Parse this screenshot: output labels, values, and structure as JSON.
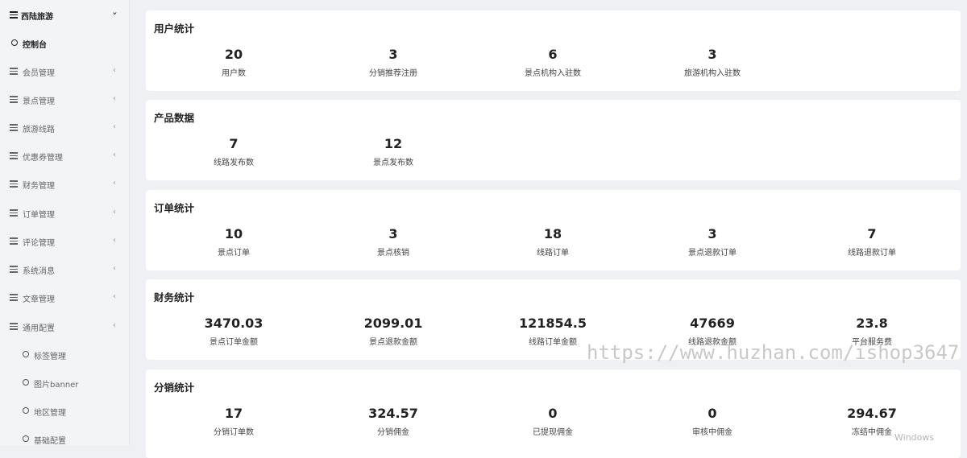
{
  "sidebar": {
    "header": "西陆旅游",
    "dashboard": "控制台",
    "menus": [
      "会员管理",
      "景点管理",
      "旅游线路",
      "优惠券管理",
      "财务管理",
      "订单管理",
      "评论管理",
      "系统消息",
      "文章管理",
      "通用配置"
    ],
    "submenus": [
      "标签管理",
      "图片banner",
      "地区管理",
      "基础配置"
    ]
  },
  "sections": [
    {
      "title": "用户统计",
      "stats": [
        {
          "value": "20",
          "label": "用户数"
        },
        {
          "value": "3",
          "label": "分销推荐注册"
        },
        {
          "value": "6",
          "label": "景点机构入驻数"
        },
        {
          "value": "3",
          "label": "旅游机构入驻数"
        }
      ]
    },
    {
      "title": "产品数据",
      "stats": [
        {
          "value": "7",
          "label": "线路发布数"
        },
        {
          "value": "12",
          "label": "景点发布数"
        }
      ]
    },
    {
      "title": "订单统计",
      "stats": [
        {
          "value": "10",
          "label": "景点订单"
        },
        {
          "value": "3",
          "label": "景点核销"
        },
        {
          "value": "18",
          "label": "线路订单"
        },
        {
          "value": "3",
          "label": "景点退款订单"
        },
        {
          "value": "7",
          "label": "线路退款订单"
        }
      ]
    },
    {
      "title": "财务统计",
      "stats": [
        {
          "value": "3470.03",
          "label": "景点订单金额"
        },
        {
          "value": "2099.01",
          "label": "景点退款金额"
        },
        {
          "value": "121854.5",
          "label": "线路订单金额"
        },
        {
          "value": "47669",
          "label": "线路退款金额"
        },
        {
          "value": "23.8",
          "label": "平台服务费"
        }
      ]
    },
    {
      "title": "分销统计",
      "stats": [
        {
          "value": "17",
          "label": "分销订单数"
        },
        {
          "value": "324.57",
          "label": "分销佣金"
        },
        {
          "value": "0",
          "label": "已提现佣金"
        },
        {
          "value": "0",
          "label": "审核中佣金"
        },
        {
          "value": "294.67",
          "label": "冻结中佣金"
        }
      ]
    }
  ],
  "watermark": "https://www.huzhan.com/ishop3647",
  "os_watermark": "Windows"
}
